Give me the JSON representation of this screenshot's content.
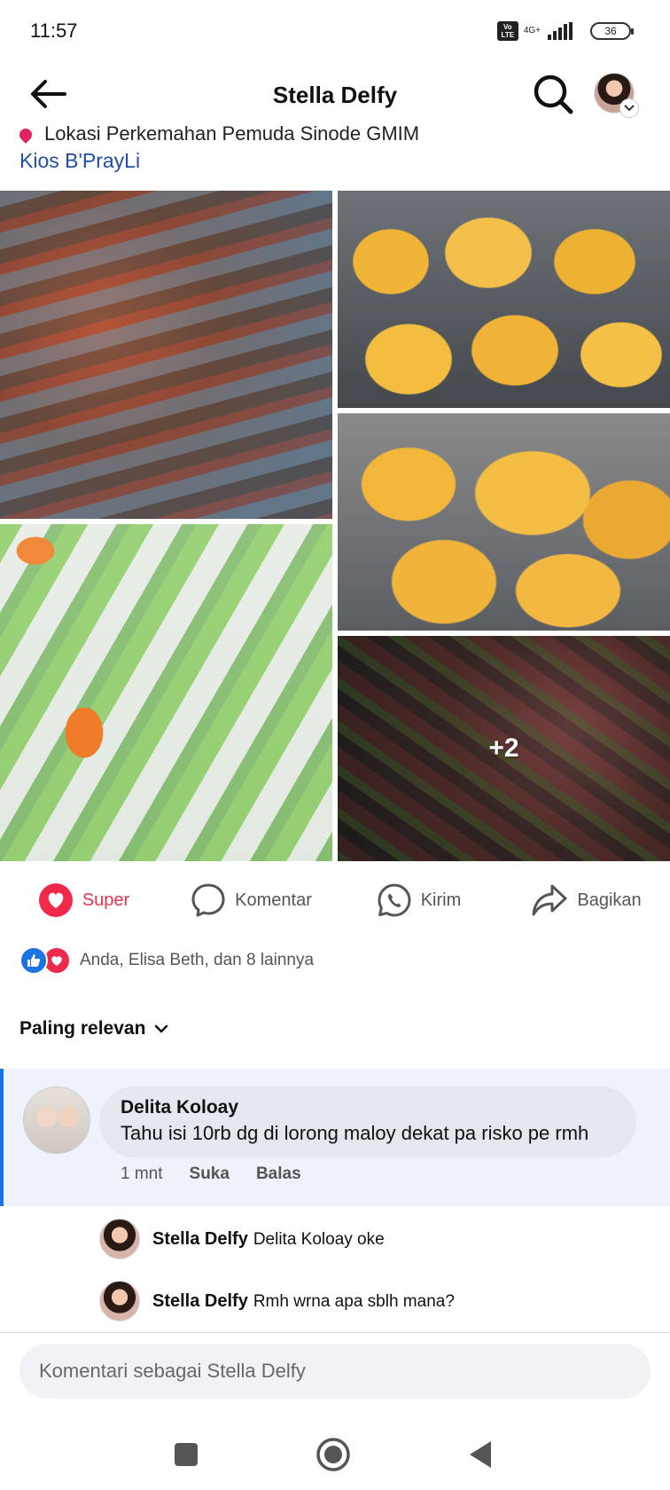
{
  "status_bar": {
    "time": "11:57",
    "volte_top": "Vo",
    "volte_bottom": "LTE",
    "network": "4G+",
    "battery": "36"
  },
  "header": {
    "title": "Stella Delfy"
  },
  "post": {
    "location_text": "Lokasi Perkemahan Pemuda Sinode GMIM",
    "link_text": "Kios B'PrayLi",
    "more_photos": "+2"
  },
  "actions": {
    "super": "Super",
    "comment": "Komentar",
    "send": "Kirim",
    "share": "Bagikan"
  },
  "reactions": {
    "summary": "Anda, Elisa Beth, dan 8 lainnya"
  },
  "sort": {
    "label": "Paling relevan"
  },
  "comment": {
    "author": "Delita Koloay",
    "text": "Tahu isi  10rb dg di lorong maloy dekat pa risko pe rmh",
    "time": "1 mnt",
    "like": "Suka",
    "reply": "Balas"
  },
  "replies": [
    {
      "author": "Stella Delfy",
      "text": "Delita Koloay oke"
    },
    {
      "author": "Stella Delfy",
      "text": "Rmh wrna apa sblh mana?"
    }
  ],
  "composer": {
    "placeholder": "Komentari sebagai Stella Delfy"
  },
  "colors": {
    "super_red": "#e4344f",
    "link_blue": "#1f4fa3",
    "like_blue": "#1b74e4"
  }
}
